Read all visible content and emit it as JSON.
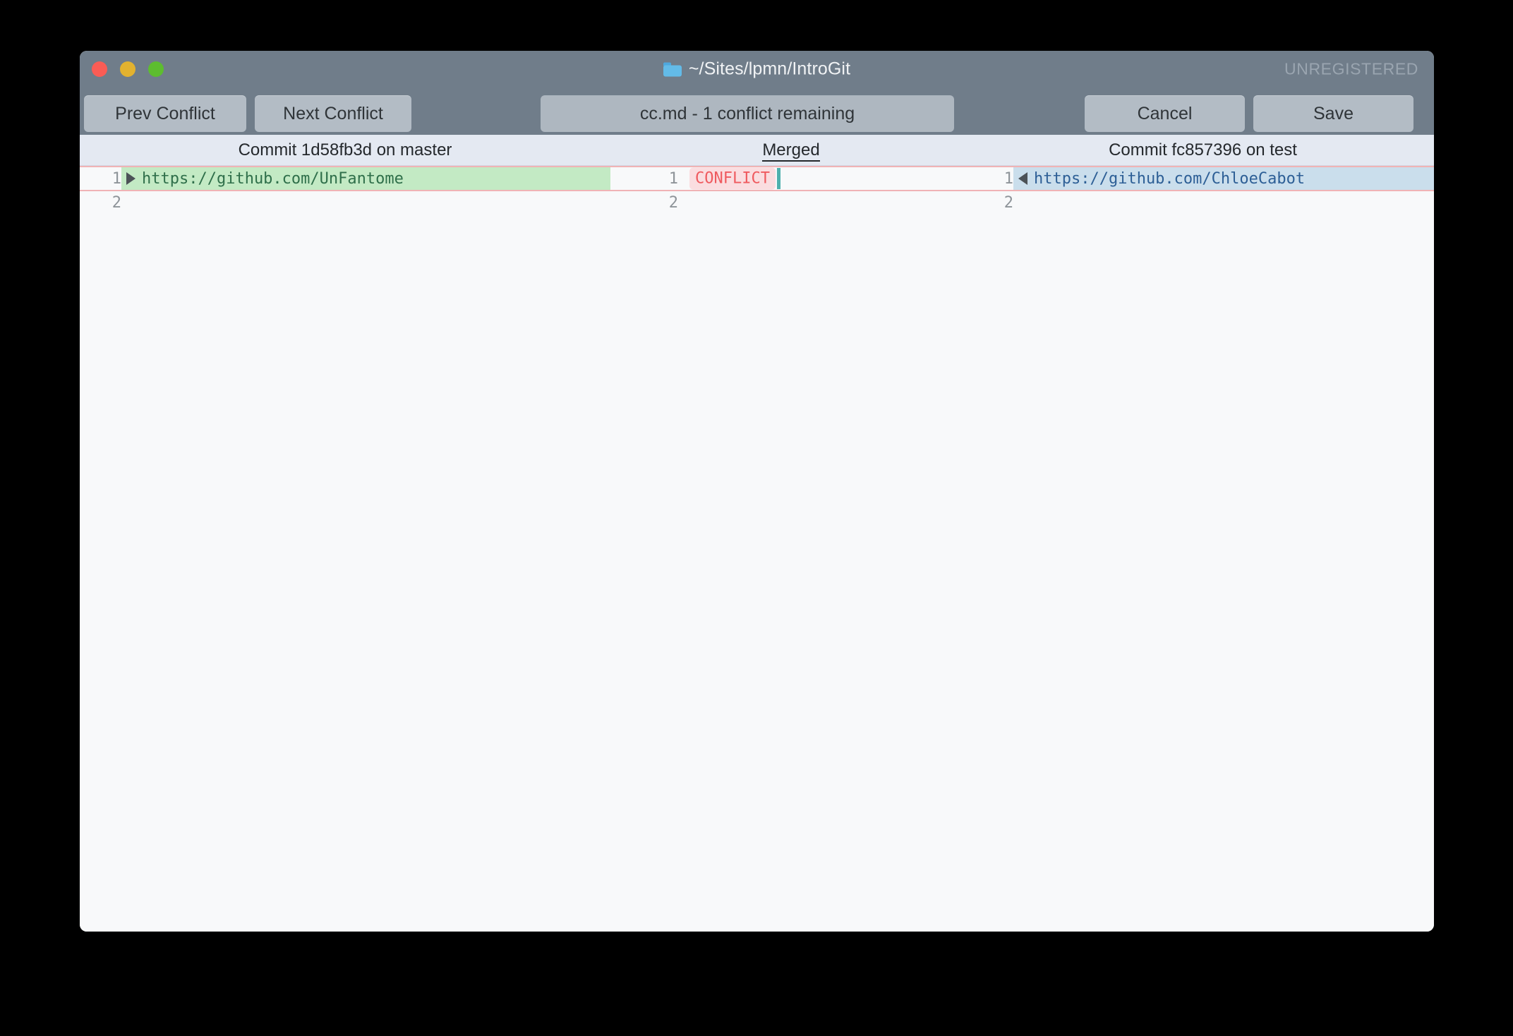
{
  "window": {
    "title": "~/Sites/lpmn/IntroGit",
    "title_icon": "folder-icon",
    "license_badge": "UNREGISTERED",
    "traffic_lights": [
      {
        "name": "close",
        "color": "#fb5c55"
      },
      {
        "name": "minimize",
        "color": "#e3b22f"
      },
      {
        "name": "maximize",
        "color": "#5dbd2f"
      }
    ]
  },
  "toolbar": {
    "prev_conflict_label": "Prev Conflict",
    "next_conflict_label": "Next Conflict",
    "file_status": "cc.md - 1 conflict remaining",
    "cancel_label": "Cancel",
    "save_label": "Save"
  },
  "panes": {
    "left_header": "Commit 1d58fb3d on master",
    "merged_header": "Merged",
    "right_header": "Commit fc857396 on test"
  },
  "diff": {
    "left": {
      "lines": [
        {
          "number": "1",
          "text": "https://github.com/UnFantome",
          "arrow": "arrow-right-icon",
          "highlight": "#c3eac4"
        },
        {
          "number": "2",
          "text": "",
          "arrow": "",
          "highlight": ""
        }
      ]
    },
    "merged": {
      "lines": [
        {
          "number": "1",
          "text": "CONFLICT",
          "caret": true
        },
        {
          "number": "2",
          "text": "",
          "caret": false
        }
      ]
    },
    "right": {
      "lines": [
        {
          "number": "1",
          "text": "https://github.com/ChloeCabot",
          "arrow": "arrow-left-icon",
          "highlight": "#cadeec"
        },
        {
          "number": "2",
          "text": "",
          "arrow": "",
          "highlight": ""
        }
      ]
    }
  },
  "colors": {
    "titlebar": "#707d8a",
    "button": "#b3bcc5",
    "header_row": "#e4e9f2",
    "added_green": "#c3eac4",
    "theirs_blue": "#cadeec",
    "conflict_red": "#ef5a5f",
    "conflict_red_bg": "#fadde0",
    "conflict_border": "#f0b3b5",
    "caret_teal": "#4eb0ad",
    "body_bg": "#f8f9fa"
  }
}
